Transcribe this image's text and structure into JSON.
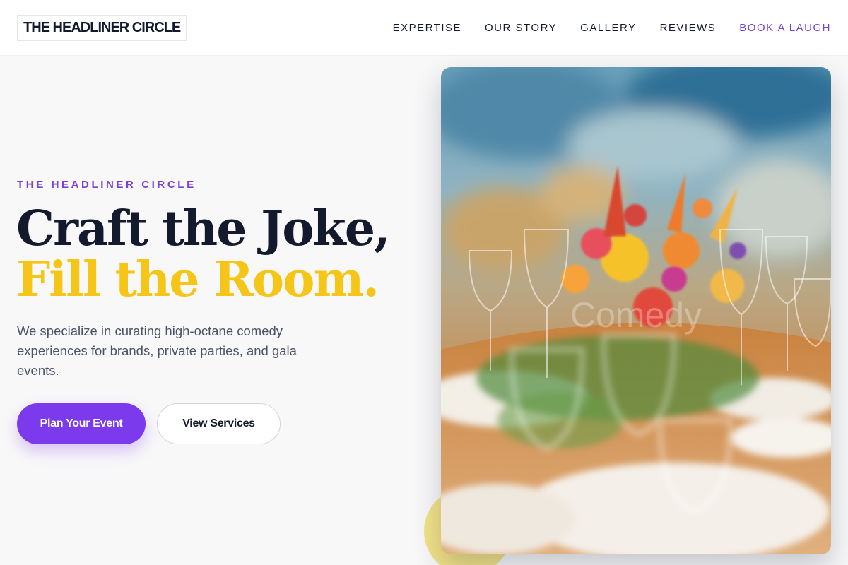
{
  "header": {
    "logo": "THE HEADLINER CIRCLE",
    "nav": [
      {
        "label": "EXPERTISE"
      },
      {
        "label": "OUR STORY"
      },
      {
        "label": "GALLERY"
      },
      {
        "label": "REVIEWS"
      },
      {
        "label": "BOOK A LAUGH"
      }
    ]
  },
  "hero": {
    "eyebrow": "THE HEADLINER CIRCLE",
    "headline_line1": "Craft the Joke,",
    "headline_line2": "Fill the Room.",
    "subtext": "We specialize in curating high-octane comedy experiences for brands, private parties, and gala events.",
    "primary_button": "Plan Your Event",
    "secondary_button": "View Services",
    "image_watermark": "Comedy"
  },
  "colors": {
    "accent_purple": "#7c3aed",
    "accent_yellow": "#f5c518",
    "text_dark": "#141a2e",
    "text_muted": "#4a5468"
  }
}
